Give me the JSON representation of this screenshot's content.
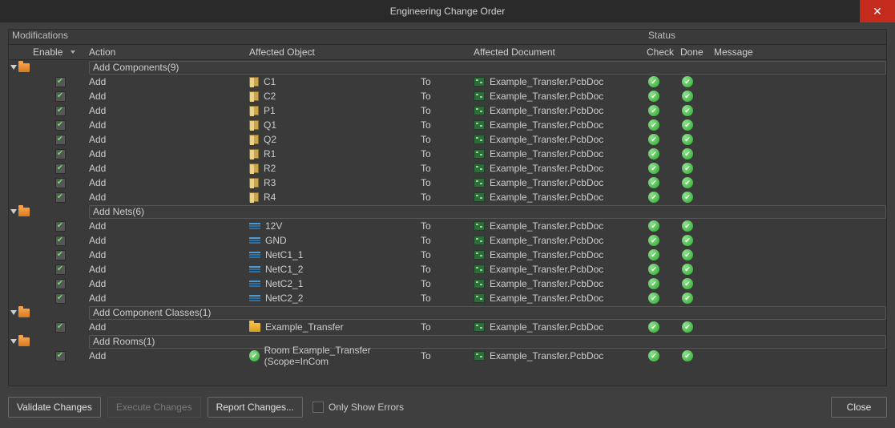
{
  "title": "Engineering Change Order",
  "sections": {
    "modifications": "Modifications",
    "status": "Status"
  },
  "columns": {
    "enable": "Enable",
    "action": "Action",
    "affected_object": "Affected Object",
    "affected_document": "Affected Document",
    "check": "Check",
    "done": "Done",
    "message": "Message"
  },
  "to_label": "To",
  "groups": [
    {
      "label": "Add Components(9)",
      "icon": "folder",
      "rows": [
        {
          "action": "Add",
          "obj": "C1",
          "obj_icon": "comp",
          "doc": "Example_Transfer.PcbDoc",
          "check": true,
          "done": true
        },
        {
          "action": "Add",
          "obj": "C2",
          "obj_icon": "comp",
          "doc": "Example_Transfer.PcbDoc",
          "check": true,
          "done": true
        },
        {
          "action": "Add",
          "obj": "P1",
          "obj_icon": "comp",
          "doc": "Example_Transfer.PcbDoc",
          "check": true,
          "done": true
        },
        {
          "action": "Add",
          "obj": "Q1",
          "obj_icon": "comp",
          "doc": "Example_Transfer.PcbDoc",
          "check": true,
          "done": true
        },
        {
          "action": "Add",
          "obj": "Q2",
          "obj_icon": "comp",
          "doc": "Example_Transfer.PcbDoc",
          "check": true,
          "done": true
        },
        {
          "action": "Add",
          "obj": "R1",
          "obj_icon": "comp",
          "doc": "Example_Transfer.PcbDoc",
          "check": true,
          "done": true
        },
        {
          "action": "Add",
          "obj": "R2",
          "obj_icon": "comp",
          "doc": "Example_Transfer.PcbDoc",
          "check": true,
          "done": true
        },
        {
          "action": "Add",
          "obj": "R3",
          "obj_icon": "comp",
          "doc": "Example_Transfer.PcbDoc",
          "check": true,
          "done": true
        },
        {
          "action": "Add",
          "obj": "R4",
          "obj_icon": "comp",
          "doc": "Example_Transfer.PcbDoc",
          "check": true,
          "done": true
        }
      ]
    },
    {
      "label": "Add Nets(6)",
      "icon": "folder",
      "rows": [
        {
          "action": "Add",
          "obj": "12V",
          "obj_icon": "net",
          "doc": "Example_Transfer.PcbDoc",
          "check": true,
          "done": true
        },
        {
          "action": "Add",
          "obj": "GND",
          "obj_icon": "net",
          "doc": "Example_Transfer.PcbDoc",
          "check": true,
          "done": true
        },
        {
          "action": "Add",
          "obj": "NetC1_1",
          "obj_icon": "net",
          "doc": "Example_Transfer.PcbDoc",
          "check": true,
          "done": true
        },
        {
          "action": "Add",
          "obj": "NetC1_2",
          "obj_icon": "net",
          "doc": "Example_Transfer.PcbDoc",
          "check": true,
          "done": true
        },
        {
          "action": "Add",
          "obj": "NetC2_1",
          "obj_icon": "net",
          "doc": "Example_Transfer.PcbDoc",
          "check": true,
          "done": true
        },
        {
          "action": "Add",
          "obj": "NetC2_2",
          "obj_icon": "net",
          "doc": "Example_Transfer.PcbDoc",
          "check": true,
          "done": true
        }
      ]
    },
    {
      "label": "Add Component Classes(1)",
      "icon": "folder",
      "rows": [
        {
          "action": "Add",
          "obj": "Example_Transfer",
          "obj_icon": "folder",
          "doc": "Example_Transfer.PcbDoc",
          "check": true,
          "done": true
        }
      ]
    },
    {
      "label": "Add Rooms(1)",
      "icon": "folder",
      "rows": [
        {
          "action": "Add",
          "obj": "Room Example_Transfer (Scope=InCom",
          "obj_icon": "green",
          "doc": "Example_Transfer.PcbDoc",
          "check": true,
          "done": true
        }
      ]
    }
  ],
  "buttons": {
    "validate": "Validate Changes",
    "execute": "Execute Changes",
    "report": "Report Changes...",
    "only_errors": "Only Show Errors",
    "close": "Close"
  }
}
